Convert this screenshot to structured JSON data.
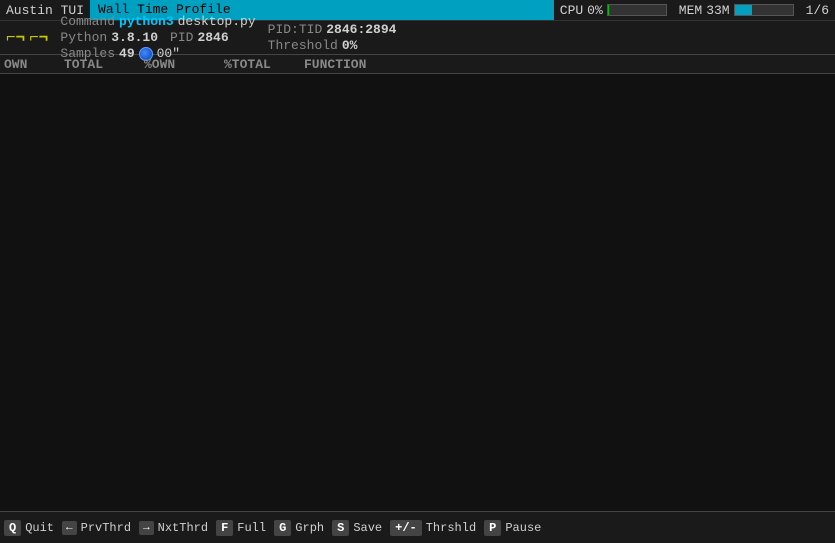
{
  "titlebar": {
    "app_name": "Austin TUI",
    "profile_tab": "Wall Time Profile",
    "cpu_label": "CPU",
    "cpu_value": "0%",
    "mem_label": "MEM",
    "mem_value": "33M",
    "page_indicator": "1/6"
  },
  "info": {
    "command_label": "Command",
    "command_value": "python3",
    "command_arg": "desktop.py",
    "python_label": "Python",
    "python_version": "3.8.10",
    "pid_label": "PID",
    "pid_value": "2846",
    "pid_tid_label": "PID:TID",
    "pid_tid_value": "2846:2894",
    "samples_label": "Samples",
    "samples_value": "49",
    "duration_value": "00\"",
    "threshold_label": "Threshold",
    "threshold_value": "0%"
  },
  "columns": {
    "own": "OWN",
    "total": "TOTAL",
    "pown": "%OWN",
    "ptotal": "%TOTAL",
    "function": "FUNCTION"
  },
  "bottombar": {
    "keys": [
      {
        "key": "Q",
        "label": "Quit"
      },
      {
        "key": "←",
        "label": "PrvThrd"
      },
      {
        "key": "→",
        "label": "NxtThrd"
      },
      {
        "key": "F",
        "label": "Full"
      },
      {
        "key": "G",
        "label": "Grph"
      },
      {
        "key": "S",
        "label": "Save"
      },
      {
        "key": "+/-",
        "label": "Thrshld"
      },
      {
        "key": "P",
        "label": "Pause"
      }
    ]
  }
}
